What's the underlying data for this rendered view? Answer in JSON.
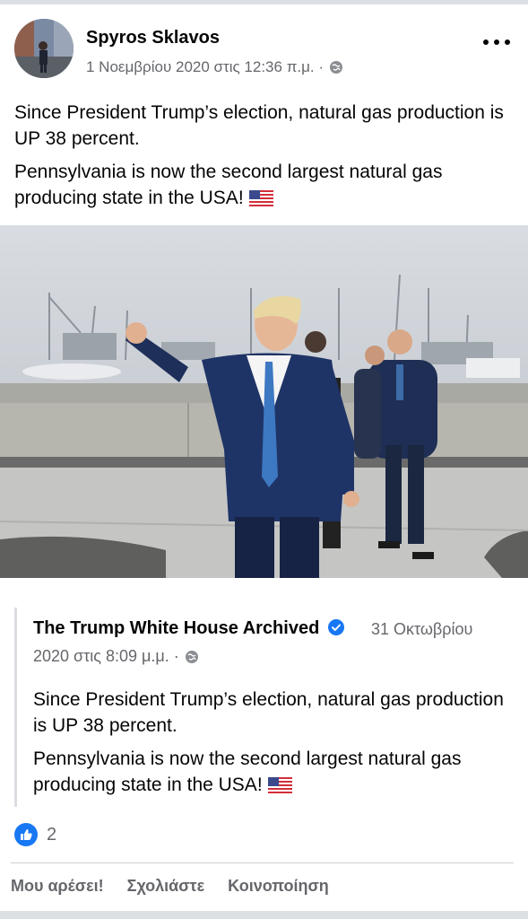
{
  "post": {
    "author": "Spyros Sklavos",
    "date": "1 Νοεμβρίου 2020 στις 12:36 π.μ. ·",
    "text_line1": "Since President Trump’s election, natural gas production is UP 38 percent.",
    "text_line2": "Pennsylvania is now the second largest natural gas producing state in the USA!",
    "flag_emoji": "🇺🇸"
  },
  "shared": {
    "author": "The Trump White House Archived",
    "date_part1": "31 Οκτωβρίου",
    "date_part2": "2020 στις 8:09 μ.μ. ·",
    "text_line1": "Since President Trump’s election, natural gas production is UP 38 percent.",
    "text_line2": "Pennsylvania is now the second largest natural gas producing state in the USA!"
  },
  "reactions": {
    "count": "2"
  },
  "actions": {
    "like": "Μου αρέσει!",
    "comment": "Σχολιάστε",
    "share": "Κοινοποίηση"
  },
  "colors": {
    "facebook_blue": "#1877f2",
    "secondary_text": "#65676b"
  },
  "icons": [
    "avatar",
    "globe-icon",
    "more-options-icon",
    "verified-badge-icon",
    "like-reaction-icon",
    "us-flag-icon"
  ]
}
